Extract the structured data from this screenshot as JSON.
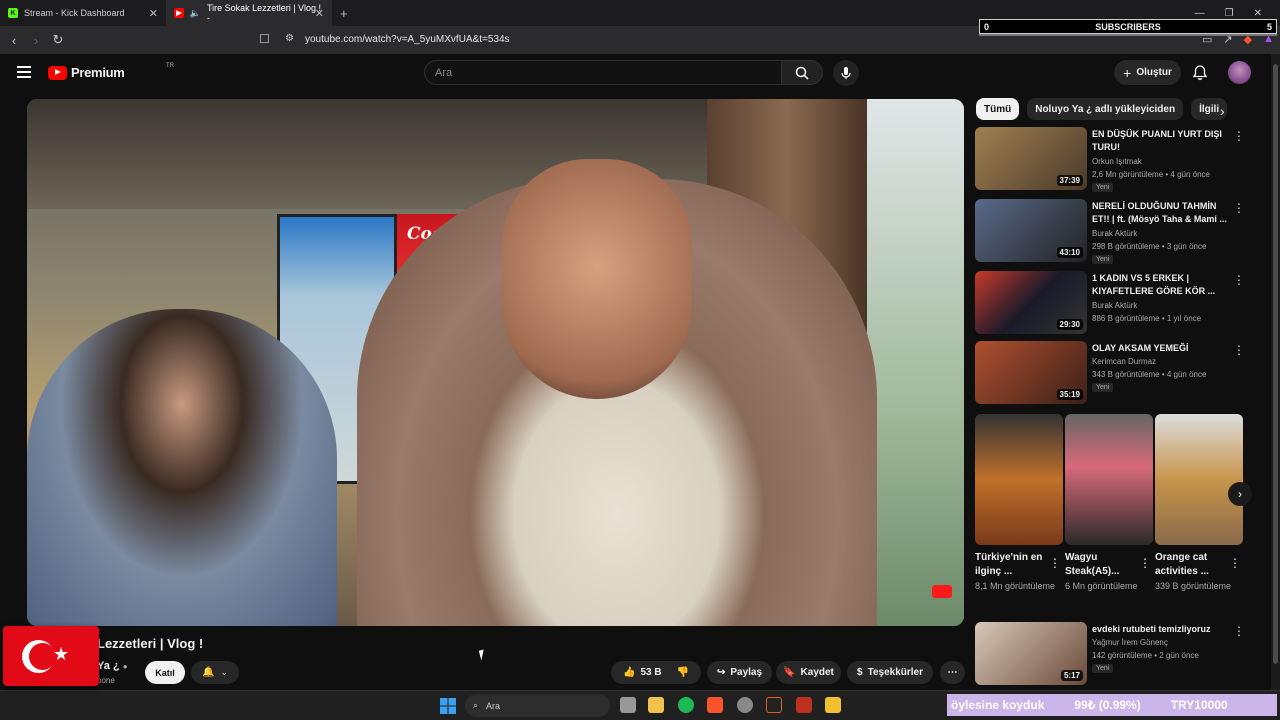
{
  "browser": {
    "tabs": [
      {
        "title": "Stream - Kick Dashboard",
        "active": false,
        "favicon": "kick-icon",
        "favicon_color": "#53fc18"
      },
      {
        "title": "Tire Sokak Lezzetleri | Vlog ! -",
        "active": true,
        "favicon": "youtube-icon",
        "favicon_color": "#ff0000"
      }
    ],
    "url": "youtube.com/watch?v=A_5yuMXvfUA&t=534s"
  },
  "overlay": {
    "subscribers_label": "SUBSCRIBERS",
    "subscribers_left": "0",
    "subscribers_right": "5"
  },
  "youtube": {
    "logo_text": "Premium",
    "logo_sup": "TR",
    "search_placeholder": "Ara",
    "create_label": "Oluştur"
  },
  "video": {
    "title": "Lezzetleri | Vlog !",
    "channel": "Ya ¿",
    "subscribers": "bone",
    "join_label": "Katıl",
    "likes": "53 B",
    "share_label": "Paylaş",
    "save_label": "Kaydet",
    "thanks_label": "Teşekkürler"
  },
  "chips": [
    "Tümü",
    "Noluyo Ya ¿ adlı yükleyiciden",
    "İlgili"
  ],
  "recommendations": [
    {
      "title": "EN DÜŞÜK PUANLI YURT DIŞI TURU!",
      "channel": "Orkun Işıtmak",
      "views": "2,6 Mn görüntüleme • 4 gün önce",
      "badge": "Yeni",
      "duration": "37:39",
      "thumb_color": "#6d5a3a"
    },
    {
      "title": "NERELİ OLDUĞUNU TAHMİN ET!! | ft. (Mösyö Taha & Mami ...",
      "channel": "Burak Aktürk",
      "views": "298 B görüntüleme • 3 gün önce",
      "badge": "Yeni",
      "duration": "43:10",
      "thumb_color": "#3a4a6a"
    },
    {
      "title": "1 KADIN VS 5 ERKEK | KIYAFETLERE GÖRE KÖR ...",
      "channel": "Burak Aktürk",
      "views": "886 B görüntüleme • 1 yıl önce",
      "badge": "",
      "duration": "29:30",
      "thumb_color": "#2a2a3a"
    },
    {
      "title": "OLAY AKSAM YEMEĞİ",
      "channel": "Kerimcan Durmaz",
      "views": "343 B görüntüleme • 4 gün önce",
      "badge": "Yeni",
      "duration": "35:19",
      "thumb_color": "#7a3a2a"
    },
    {
      "title": "evdeki rutubeti temizliyoruz",
      "channel": "Yağmur İrem Gönenç",
      "views": "142 görüntüleme • 2 gün önce",
      "badge": "Yeni",
      "duration": "5:17",
      "thumb_color": "#8a7a6a"
    }
  ],
  "shorts": [
    {
      "title": "Türkiye'nin en ilginç ...",
      "views": "8,1 Mn görüntüleme",
      "thumb_color": "#c0702a"
    },
    {
      "title": "Wagyu Steak(A5)...",
      "views": "6 Mn görüntüleme",
      "thumb_color": "#d86a7a"
    },
    {
      "title": "Orange cat activities ...",
      "views": "339 B görüntüleme",
      "thumb_color": "#c8944a"
    }
  ],
  "taskbar": {
    "search_placeholder": "Ara"
  },
  "ticker": {
    "text1": "öylesine koyduk",
    "text2": "99₺ (0.99%)",
    "text3": "TRY10000"
  }
}
